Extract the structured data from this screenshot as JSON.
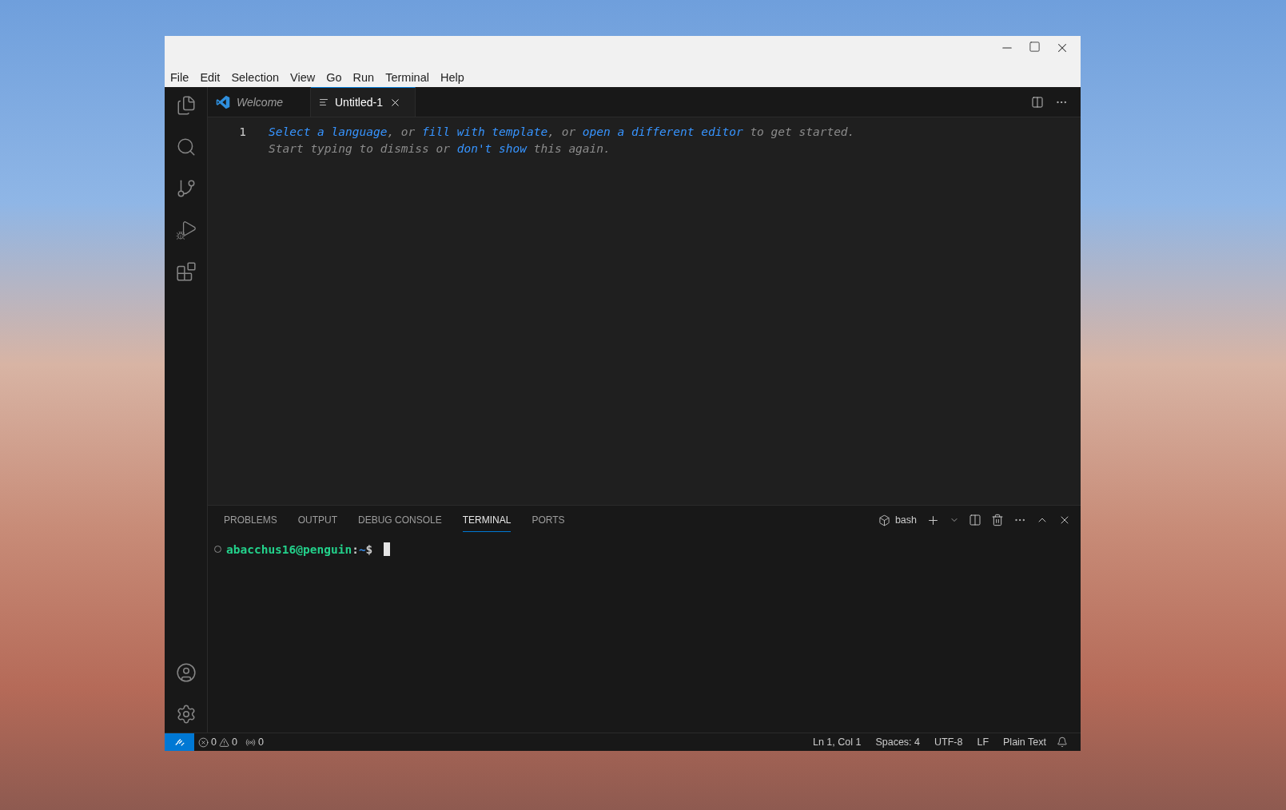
{
  "menu": [
    {
      "label": "File"
    },
    {
      "label": "Edit"
    },
    {
      "label": "Selection"
    },
    {
      "label": "View"
    },
    {
      "label": "Go"
    },
    {
      "label": "Run"
    },
    {
      "label": "Terminal"
    },
    {
      "label": "Help"
    }
  ],
  "tabs": [
    {
      "label": "Welcome",
      "kind": "preview",
      "selected": false
    },
    {
      "label": "Untitled-1",
      "kind": "file",
      "selected": true
    }
  ],
  "editor": {
    "line_number": "1",
    "hint_lines": [
      [
        {
          "kind": "link",
          "text": "Select a language"
        },
        {
          "kind": "plain",
          "text": ", or "
        },
        {
          "kind": "link",
          "text": "fill with template"
        },
        {
          "kind": "plain",
          "text": ", or "
        },
        {
          "kind": "link",
          "text": "open a different editor"
        },
        {
          "kind": "plain",
          "text": " to get started."
        }
      ],
      [
        {
          "kind": "plain",
          "text": "Start typing to dismiss or "
        },
        {
          "kind": "link",
          "text": "don't show"
        },
        {
          "kind": "plain",
          "text": " this again."
        }
      ]
    ]
  },
  "panel": {
    "tabs": [
      {
        "label": "PROBLEMS",
        "selected": false
      },
      {
        "label": "OUTPUT",
        "selected": false
      },
      {
        "label": "DEBUG CONSOLE",
        "selected": false
      },
      {
        "label": "TERMINAL",
        "selected": true
      },
      {
        "label": "PORTS",
        "selected": false
      }
    ],
    "shell": "bash",
    "prompt": {
      "user": "abacchus16@penguin",
      "separator": ":",
      "path": "~",
      "symbol": "$"
    }
  },
  "status_bar": {
    "errors": "0",
    "warnings": "0",
    "ports": "0",
    "items": [
      "Ln 1, Col 1",
      "Spaces: 4",
      "UTF-8",
      "LF",
      "Plain Text"
    ]
  }
}
